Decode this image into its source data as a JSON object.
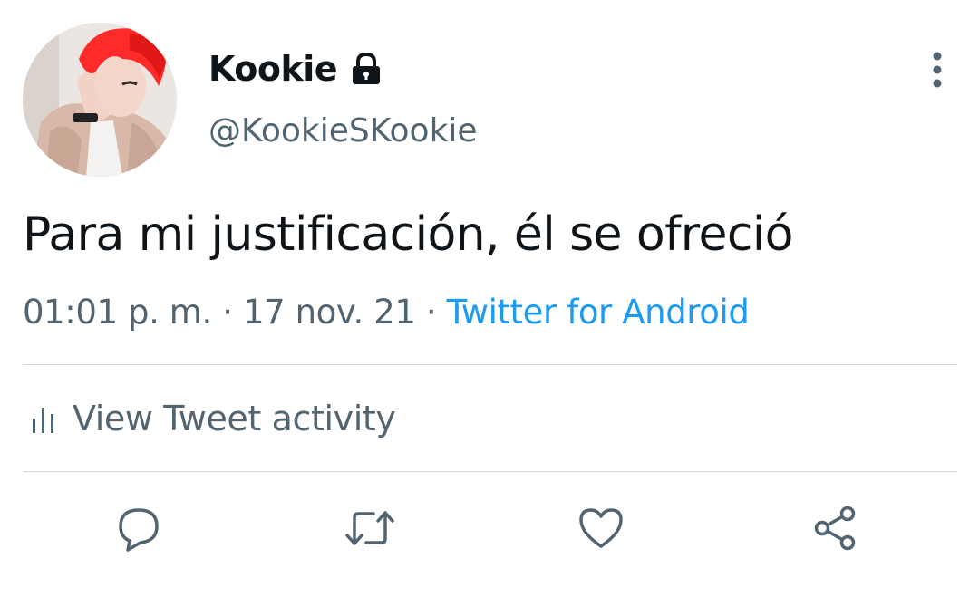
{
  "tweet": {
    "display_name": "Kookie",
    "handle": "@KookieSKookie",
    "text": "Para mi justificación, él se ofreció",
    "time": "01:01 p. m.",
    "separator": "·",
    "date": "17 nov. 21",
    "source": "Twitter for Android",
    "activity_label": "View Tweet activity"
  },
  "icons": {
    "lock": "lock-icon",
    "more": "more-vertical-icon",
    "activity": "bar-chart-icon",
    "reply": "reply-icon",
    "retweet": "retweet-icon",
    "like": "heart-icon",
    "share": "share-icon"
  },
  "colors": {
    "text": "#0f1419",
    "secondary": "#536471",
    "link": "#1d9bf0",
    "divider": "#cfd9de",
    "avatar_hair": "#ff2a2a"
  }
}
